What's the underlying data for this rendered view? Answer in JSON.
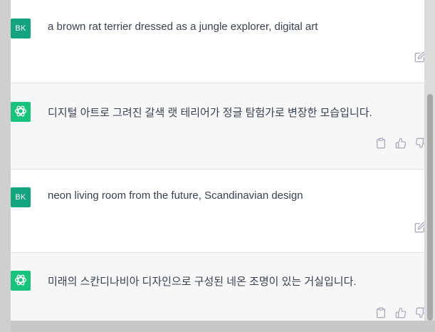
{
  "conversation": {
    "messages": [
      {
        "role": "user",
        "avatar_initials": "BK",
        "text": "a brown rat terrier dressed as a jungle explorer, digital art",
        "actions": [
          "edit-icon"
        ]
      },
      {
        "role": "assistant",
        "avatar_icon": "openai-logo-icon",
        "text": "디지털 아트로 그려진 갈색 랫 테리어가 정글 탐험가로 변장한 모습입니다.",
        "actions": [
          "copy-icon",
          "thumbs-up-icon",
          "thumbs-down-icon"
        ]
      },
      {
        "role": "user",
        "avatar_initials": "BK",
        "text": "neon living room from the future, Scandinavian design",
        "actions": [
          "edit-icon"
        ]
      },
      {
        "role": "assistant",
        "avatar_icon": "openai-logo-icon",
        "text": "미래의 스칸디나비아 디자인으로 구성된 네온 조명이 있는 거실입니다.",
        "actions": [
          "copy-icon",
          "thumbs-up-icon",
          "thumbs-down-icon"
        ]
      }
    ]
  },
  "colors": {
    "user_avatar": "#14a37f",
    "assistant_avatar": "#19c37d",
    "assistant_row_bg": "#f7f7f8",
    "text": "#374151",
    "icon": "#acacbe"
  }
}
